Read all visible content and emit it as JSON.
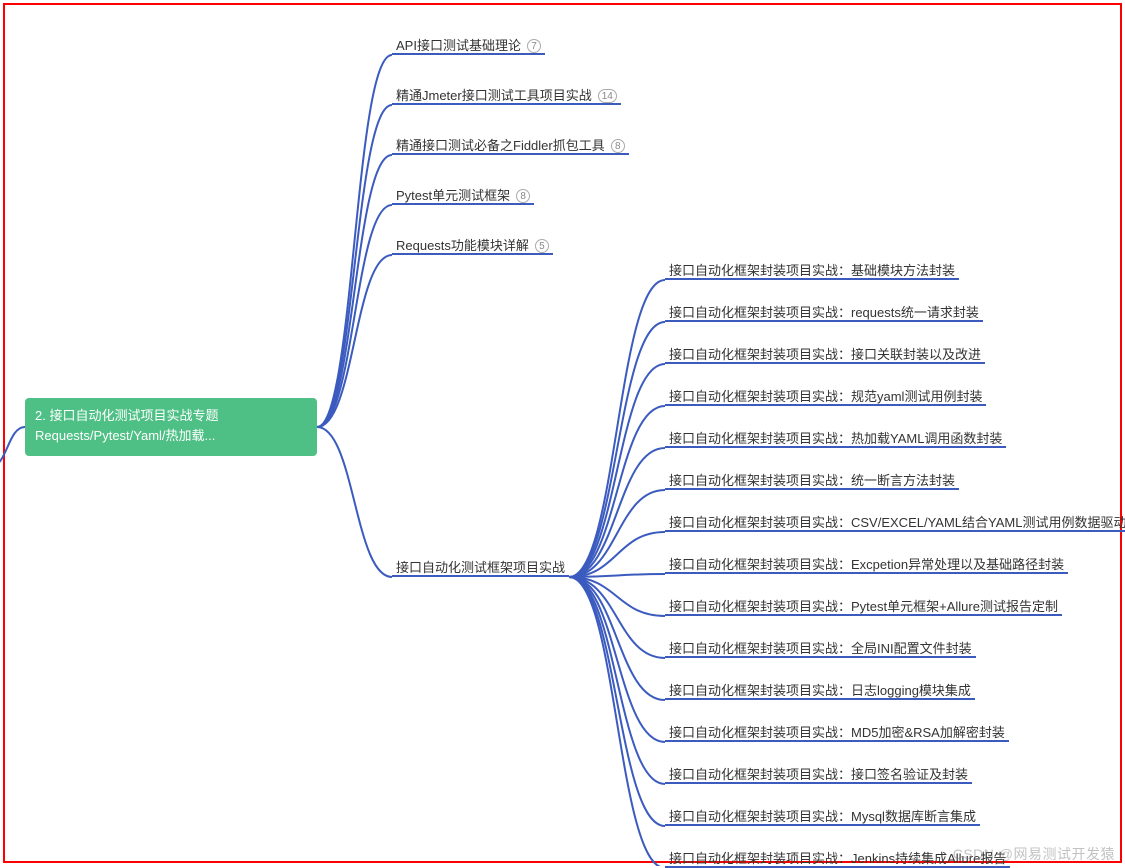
{
  "root": {
    "number": "2.",
    "line1": "接口自动化测试项目实战专题",
    "line2": "Requests/Pytest/Yaml/热加载..."
  },
  "level1": [
    {
      "label": "API接口测试基础理论",
      "count": "7"
    },
    {
      "label": "精通Jmeter接口测试工具项目实战",
      "count": "14"
    },
    {
      "label": "精通接口测试必备之Fiddler抓包工具",
      "count": "8"
    },
    {
      "label": "Pytest单元测试框架",
      "count": "8"
    },
    {
      "label": "Requests功能模块详解",
      "count": "5"
    },
    {
      "label": "接口自动化测试框架项目实战",
      "count": null
    }
  ],
  "level2": [
    {
      "label": "接口自动化框架封装项目实战：基础模块方法封装"
    },
    {
      "label": "接口自动化框架封装项目实战：requests统一请求封装"
    },
    {
      "label": "接口自动化框架封装项目实战：接口关联封装以及改进"
    },
    {
      "label": "接口自动化框架封装项目实战：规范yaml测试用例封装"
    },
    {
      "label": "接口自动化框架封装项目实战：热加载YAML调用函数封装"
    },
    {
      "label": "接口自动化框架封装项目实战：统一断言方法封装"
    },
    {
      "label": "接口自动化框架封装项目实战：CSV/EXCEL/YAML结合YAML测试用例数据驱动封装"
    },
    {
      "label": "接口自动化框架封装项目实战：Excpetion异常处理以及基础路径封装"
    },
    {
      "label": "接口自动化框架封装项目实战：Pytest单元框架+Allure测试报告定制"
    },
    {
      "label": "接口自动化框架封装项目实战：全局INI配置文件封装"
    },
    {
      "label": "接口自动化框架封装项目实战：日志logging模块集成"
    },
    {
      "label": "接口自动化框架封装项目实战：MD5加密&RSA加解密封装"
    },
    {
      "label": "接口自动化框架封装项目实战：接口签名验证及封装"
    },
    {
      "label": "接口自动化框架封装项目实战：Mysql数据库断言集成"
    },
    {
      "label": "接口自动化框架封装项目实战：Jenkins持续集成Allure报告"
    }
  ],
  "watermark": "CSDN @网易测试开发猿",
  "layout": {
    "rootRight": 317,
    "rootMidY": 427,
    "l1x": 392,
    "l1y": [
      35,
      85,
      135,
      185,
      235,
      557
    ],
    "l2x": 665,
    "l2yStart": 260,
    "l2yStep": 42
  }
}
